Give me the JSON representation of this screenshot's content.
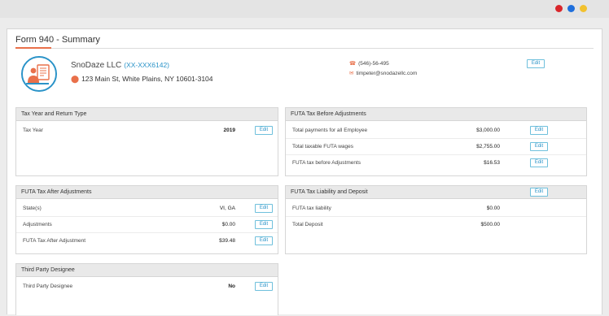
{
  "window": {
    "dots": [
      {
        "name": "red",
        "color": "#d9262b"
      },
      {
        "name": "blue",
        "color": "#1f6fdc"
      },
      {
        "name": "yellow",
        "color": "#f2c12e"
      }
    ]
  },
  "page": {
    "title": "Form 940 - Summary"
  },
  "business": {
    "name": "SnoDaze LLC",
    "ein": "(XX-XXX6142)",
    "address": "123 Main St, White Plains, NY 10601-3104",
    "phone": "(546)-56-495",
    "email": "timpeter@snodazellc.com",
    "edit_label": "Edit"
  },
  "panels": {
    "tax_year": {
      "title": "Tax Year and Return Type",
      "rows": [
        {
          "label": "Tax Year",
          "value": "2019",
          "edit": "Edit"
        }
      ]
    },
    "futa_before": {
      "title": "FUTA Tax Before Adjustments",
      "rows": [
        {
          "label": "Total payments for all Employee",
          "value": "$3,000.00",
          "edit": "Edit"
        },
        {
          "label": "Total taxable FUTA wages",
          "value": "$2,755.00",
          "edit": "Edit"
        },
        {
          "label": "FUTA tax before Adjustments",
          "value": "$16.53",
          "edit": "Edit"
        }
      ]
    },
    "futa_after": {
      "title": "FUTA Tax After Adjustments",
      "rows": [
        {
          "label": "State(s)",
          "value": "VI, GA",
          "edit": "Edit"
        },
        {
          "label": "Adjustments",
          "value": "$0.00",
          "edit": "Edit"
        },
        {
          "label": "FUTA Tax After Adjustment",
          "value": "$39.48",
          "edit": "Edit"
        }
      ]
    },
    "liability": {
      "title": "FUTA Tax Liability and Deposit",
      "edit": "Edit",
      "rows": [
        {
          "label": "FUTA tax liability",
          "value": "$0.00"
        },
        {
          "label": "Total Deposit",
          "value": "$500.00"
        }
      ]
    },
    "designee": {
      "title": "Third Party Designee",
      "rows": [
        {
          "label": "Third Party Designee",
          "value": "No",
          "edit": "Edit"
        }
      ]
    }
  }
}
